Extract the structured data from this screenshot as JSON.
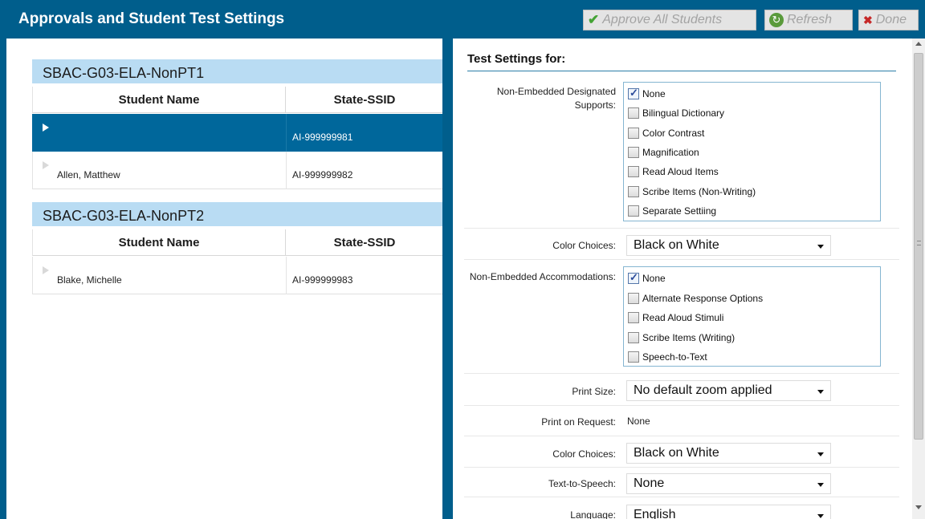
{
  "header": {
    "title": "Approvals and Student Test Settings",
    "approve_label": "Approve All Students",
    "refresh_label": "Refresh",
    "done_label": "Done",
    "bar_color": "#005e8c"
  },
  "tests": [
    {
      "name": "SBAC-G03-ELA-NonPT1",
      "col_name": "Student Name",
      "col_ssid": "State-SSID",
      "students": [
        {
          "name": "",
          "ssid": "AI-999999981",
          "selected": true
        },
        {
          "name": "Allen, Matthew",
          "ssid": "AI-999999982",
          "selected": false
        }
      ]
    },
    {
      "name": "SBAC-G03-ELA-NonPT2",
      "col_name": "Student Name",
      "col_ssid": "State-SSID",
      "students": [
        {
          "name": "Blake, Michelle",
          "ssid": "AI-999999983",
          "selected": false
        }
      ]
    }
  ],
  "settings": {
    "title": "Test Settings for:",
    "designated_supports": {
      "label": "Non-Embedded Designated Supports:",
      "options": [
        {
          "label": "None",
          "checked": true
        },
        {
          "label": "Bilingual Dictionary",
          "checked": false
        },
        {
          "label": "Color Contrast",
          "checked": false
        },
        {
          "label": "Magnification",
          "checked": false
        },
        {
          "label": "Read Aloud Items",
          "checked": false
        },
        {
          "label": "Scribe Items (Non-Writing)",
          "checked": false
        },
        {
          "label": "Separate Settiing",
          "checked": false
        }
      ]
    },
    "color_choices_1": {
      "label": "Color Choices:",
      "value": "Black on White"
    },
    "accommodations": {
      "label": "Non-Embedded Accommodations:",
      "options": [
        {
          "label": "None",
          "checked": true
        },
        {
          "label": "Alternate Response Options",
          "checked": false
        },
        {
          "label": "Read Aloud Stimuli",
          "checked": false
        },
        {
          "label": "Scribe Items (Writing)",
          "checked": false
        },
        {
          "label": "Speech-to-Text",
          "checked": false
        }
      ]
    },
    "print_size": {
      "label": "Print Size:",
      "value": "No default zoom applied"
    },
    "print_on_request": {
      "label": "Print on Request:",
      "value": "None"
    },
    "color_choices_2": {
      "label": "Color Choices:",
      "value": "Black on White"
    },
    "text_to_speech": {
      "label": "Text-to-Speech:",
      "value": "None"
    },
    "language": {
      "label": "Language:",
      "value": "English"
    }
  }
}
